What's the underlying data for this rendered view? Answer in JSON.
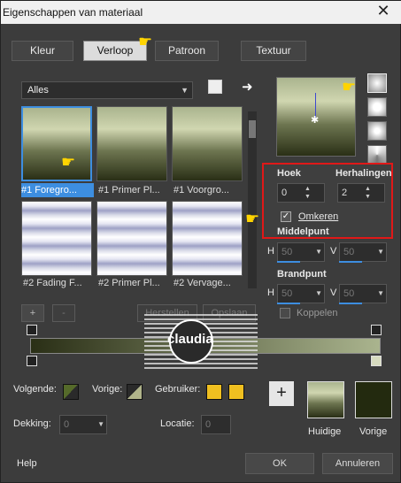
{
  "window": {
    "title": "Eigenschappen van materiaal",
    "close_label": "✕"
  },
  "tabs": [
    {
      "label": "Kleur",
      "active": false
    },
    {
      "label": "Verloop",
      "active": true
    },
    {
      "label": "Patroon",
      "active": false
    },
    {
      "label": "Textuur",
      "active": false
    }
  ],
  "category": {
    "value": "Alles"
  },
  "gradients": [
    {
      "label": "#1 Foregro..."
    },
    {
      "label": "#1 Primer Pl..."
    },
    {
      "label": "#1 Voorgro..."
    },
    {
      "label": "#2 Fading F..."
    },
    {
      "label": "#2 Primer Pl..."
    },
    {
      "label": "#2 Vervage..."
    }
  ],
  "editor": {
    "add_label": "+",
    "remove_label": "-",
    "reset_label": "Herstellen",
    "save_label": "Opslaan"
  },
  "angle": {
    "label": "Hoek",
    "value": "0"
  },
  "repeats": {
    "label": "Herhalingen",
    "value": "2"
  },
  "invert": {
    "label": "Omkeren",
    "checked": true
  },
  "center": {
    "label": "Middelpunt",
    "h_label": "H",
    "h_value": "50",
    "v_label": "V",
    "v_value": "50"
  },
  "focal": {
    "label": "Brandpunt",
    "h_label": "H",
    "h_value": "50",
    "v_label": "V",
    "v_value": "50"
  },
  "link": {
    "label": "Koppelen"
  },
  "bottom": {
    "next_label": "Volgende:",
    "prev_label": "Vorige:",
    "user_label": "Gebruiker:",
    "opacity_label": "Dekking:",
    "opacity_value": "0",
    "location_label": "Locatie:",
    "location_value": "0",
    "current_label": "Huidige",
    "previous_label": "Vorige",
    "help_label": "Help",
    "ok_label": "OK",
    "cancel_label": "Annuleren"
  },
  "watermark": {
    "text": "claudia"
  },
  "colors": {
    "accent": "#3d8ee0",
    "highlight_border": "#e01818",
    "user_color": "#f0c020"
  }
}
